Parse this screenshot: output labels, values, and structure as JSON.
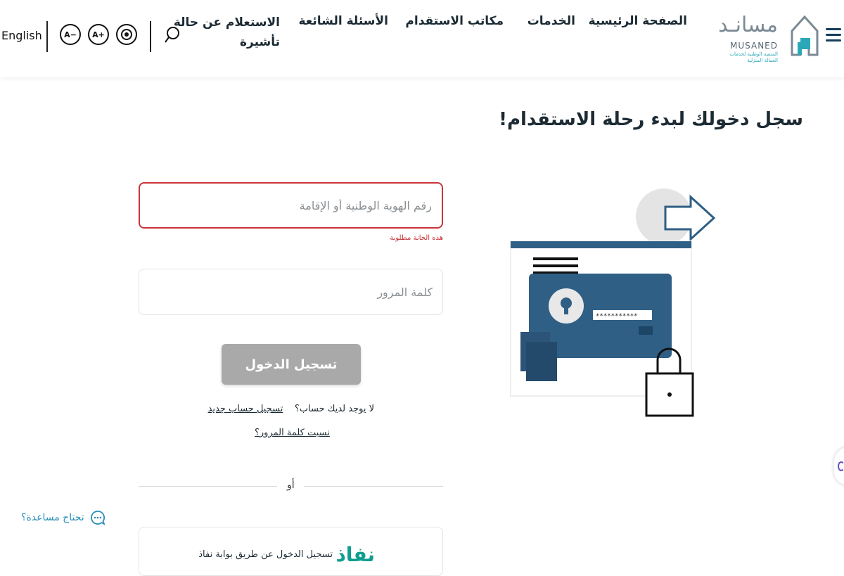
{
  "header": {
    "logo": {
      "arabic": "مسانـد",
      "english": "MUSANED",
      "tagline": "المنصة الوطنية لخدمات العمالة المنزلية"
    },
    "nav": [
      {
        "label": "الصفحة الرئيسية"
      },
      {
        "label": "الخدمات"
      },
      {
        "label": "مكاتب الاستقدام"
      },
      {
        "label": "الأسئلة الشائعة"
      },
      {
        "label_line1": "الاستعلام عن حالة",
        "label_line2": "تأشيرة"
      }
    ],
    "tools": {
      "decrease_font": "A−",
      "increase_font": "A+",
      "language": "English"
    }
  },
  "main": {
    "title": "سجل دخولك لبدء رحلة الاستقدام!",
    "id_field": {
      "placeholder": "رقم الهوية الوطنية أو الإقامة",
      "value": "",
      "error": "هذه الخانة مطلوبة"
    },
    "password_field": {
      "placeholder": "كلمة المرور",
      "value": ""
    },
    "login_button": "تسجيل الدخول",
    "no_account_text": "لا يوجد لديك حساب؟",
    "register_link": "تسجيل حساب جديد",
    "forgot_link": "نسيت كلمة المرور؟",
    "or_text": "أو",
    "nafath": {
      "logo": "نفاذ",
      "text": "تسجيل الدخول عن طريق بوابة نفاذ"
    },
    "help_text": "تحتاج مساعدة؟",
    "illustration": {
      "password_mask": "***********"
    }
  },
  "colors": {
    "primary_dark": "#1b2a33",
    "accent_teal": "#2aa8b8",
    "error": "#c9353a",
    "button_disabled": "#a9a9a9",
    "illustration_blue": "#2f5f85",
    "nafath_green": "#0f9d8f"
  }
}
